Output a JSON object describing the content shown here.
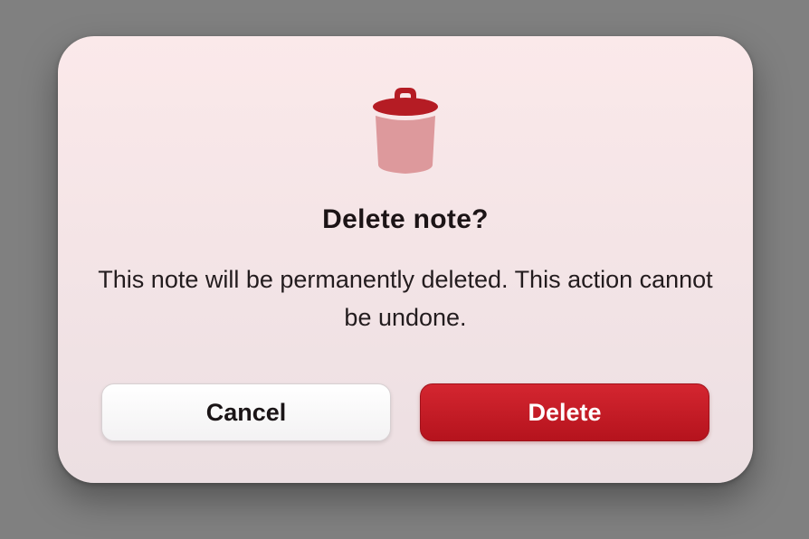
{
  "dialog": {
    "icon": "trash-icon",
    "title": "Delete note?",
    "message": "This note will be permanently deleted. This action cannot be undone.",
    "cancel_label": "Cancel",
    "delete_label": "Delete"
  },
  "colors": {
    "accent": "#c41b25",
    "icon_lid": "#b51c24",
    "icon_body": "#dd999c",
    "backdrop": "#808080"
  }
}
